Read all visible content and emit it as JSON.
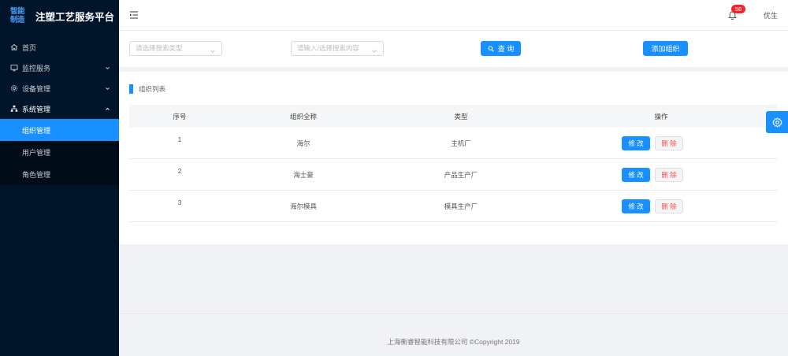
{
  "brand": {
    "logo_line1": "智能",
    "logo_line2": "制造",
    "title": "注塑工艺服务平台"
  },
  "sidebar": {
    "items": [
      {
        "label": "首页",
        "icon": "home-icon"
      },
      {
        "label": "监控服务",
        "icon": "monitor-icon"
      },
      {
        "label": "设备管理",
        "icon": "gear-icon"
      },
      {
        "label": "系统管理",
        "icon": "sitemap-icon"
      }
    ],
    "subitems": [
      {
        "label": "组织管理",
        "active": true
      },
      {
        "label": "用户管理",
        "active": false
      },
      {
        "label": "角色管理",
        "active": false
      }
    ]
  },
  "header": {
    "notification_count": "58",
    "username": "优生"
  },
  "filter": {
    "type_placeholder": "请选择搜索类型",
    "content_placeholder": "请输入/选择搜索内容",
    "search_label": "查 询",
    "add_label": "添加组织"
  },
  "list": {
    "title": "组织列表",
    "columns": [
      "序号",
      "组织全称",
      "类型",
      "操作"
    ],
    "rows": [
      {
        "index": "1",
        "name": "海尔",
        "type": "主机厂"
      },
      {
        "index": "2",
        "name": "海士豪",
        "type": "产品生产厂"
      },
      {
        "index": "3",
        "name": "海尔模具",
        "type": "模具生产厂"
      }
    ],
    "edit_label": "修 改",
    "delete_label": "删 除"
  },
  "footer": {
    "text": "上海衡睿智能科技有限公司 ©Copyright 2019"
  },
  "colors": {
    "primary": "#1890ff",
    "sidebar": "#001529",
    "danger": "#e8534f",
    "badge": "#f5222d"
  }
}
